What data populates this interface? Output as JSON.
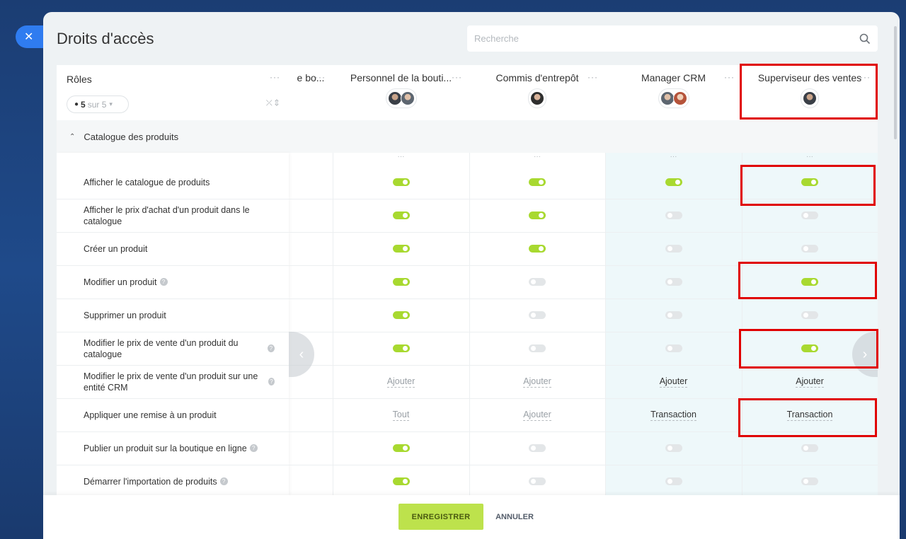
{
  "dialog": {
    "title": "Droits d'accès"
  },
  "search": {
    "placeholder": "Recherche"
  },
  "roles_header": {
    "label": "Rôles",
    "count_current": "5",
    "count_rest": "sur 5"
  },
  "columns": [
    {
      "name": "e bo...",
      "avatars": []
    },
    {
      "name": "Personnel de la bouti...",
      "avatars": [
        "av1",
        "av2"
      ]
    },
    {
      "name": "Commis d'entrepôt",
      "avatars": [
        "av3"
      ]
    },
    {
      "name": "Manager CRM",
      "avatars": [
        "av2",
        "av4"
      ]
    },
    {
      "name": "Superviseur des ventes",
      "avatars": [
        "av1"
      ]
    }
  ],
  "section": {
    "label": "Catalogue des produits"
  },
  "rows": [
    {
      "label": "Afficher le catalogue de produits",
      "help": false,
      "cells": [
        [
          "toggle",
          "on"
        ],
        [
          "toggle",
          "on"
        ],
        [
          "toggle",
          "on"
        ],
        [
          "toggle",
          "on"
        ]
      ]
    },
    {
      "label": "Afficher le prix d'achat d'un produit dans le catalogue",
      "help": false,
      "cells": [
        [
          "toggle",
          "on"
        ],
        [
          "toggle",
          "on"
        ],
        [
          "toggle",
          "off"
        ],
        [
          "toggle",
          "off"
        ]
      ]
    },
    {
      "label": "Créer un produit",
      "help": false,
      "cells": [
        [
          "toggle",
          "on"
        ],
        [
          "toggle",
          "on"
        ],
        [
          "toggle",
          "off"
        ],
        [
          "toggle",
          "off"
        ]
      ]
    },
    {
      "label": "Modifier un produit",
      "help": true,
      "cells": [
        [
          "toggle",
          "on"
        ],
        [
          "toggle",
          "off"
        ],
        [
          "toggle",
          "off"
        ],
        [
          "toggle",
          "on"
        ]
      ]
    },
    {
      "label": "Supprimer un produit",
      "help": false,
      "cells": [
        [
          "toggle",
          "on"
        ],
        [
          "toggle",
          "off"
        ],
        [
          "toggle",
          "off"
        ],
        [
          "toggle",
          "off"
        ]
      ]
    },
    {
      "label": "Modifier le prix de vente d'un produit du catalogue",
      "help": true,
      "cells": [
        [
          "toggle",
          "on"
        ],
        [
          "toggle",
          "off"
        ],
        [
          "toggle",
          "off"
        ],
        [
          "toggle",
          "on"
        ]
      ]
    },
    {
      "label": "Modifier le prix de vente d'un produit sur une entité CRM",
      "help": true,
      "cells": [
        [
          "text",
          "Ajouter",
          "muted"
        ],
        [
          "text",
          "Ajouter",
          "muted"
        ],
        [
          "text",
          "Ajouter",
          ""
        ],
        [
          "text",
          "Ajouter",
          ""
        ]
      ]
    },
    {
      "label": "Appliquer une remise à un produit",
      "help": false,
      "cells": [
        [
          "text",
          "Tout",
          "muted"
        ],
        [
          "text",
          "Ajouter",
          "muted"
        ],
        [
          "text",
          "Transaction",
          ""
        ],
        [
          "text",
          "Transaction",
          ""
        ]
      ]
    },
    {
      "label": "Publier un produit sur la boutique en ligne",
      "help": true,
      "cells": [
        [
          "toggle",
          "on"
        ],
        [
          "toggle",
          "off"
        ],
        [
          "toggle",
          "off"
        ],
        [
          "toggle",
          "off"
        ]
      ]
    },
    {
      "label": "Démarrer l'importation de produits",
      "help": true,
      "cells": [
        [
          "toggle",
          "on"
        ],
        [
          "toggle",
          "off"
        ],
        [
          "toggle",
          "off"
        ],
        [
          "toggle",
          "off"
        ]
      ]
    }
  ],
  "footer": {
    "save": "ENREGISTRER",
    "cancel": "ANNULER"
  },
  "colors": {
    "accent": "#bde24c",
    "toggle_on": "#a8d930",
    "highlight": "#e00000",
    "close": "#2f7cf0"
  }
}
